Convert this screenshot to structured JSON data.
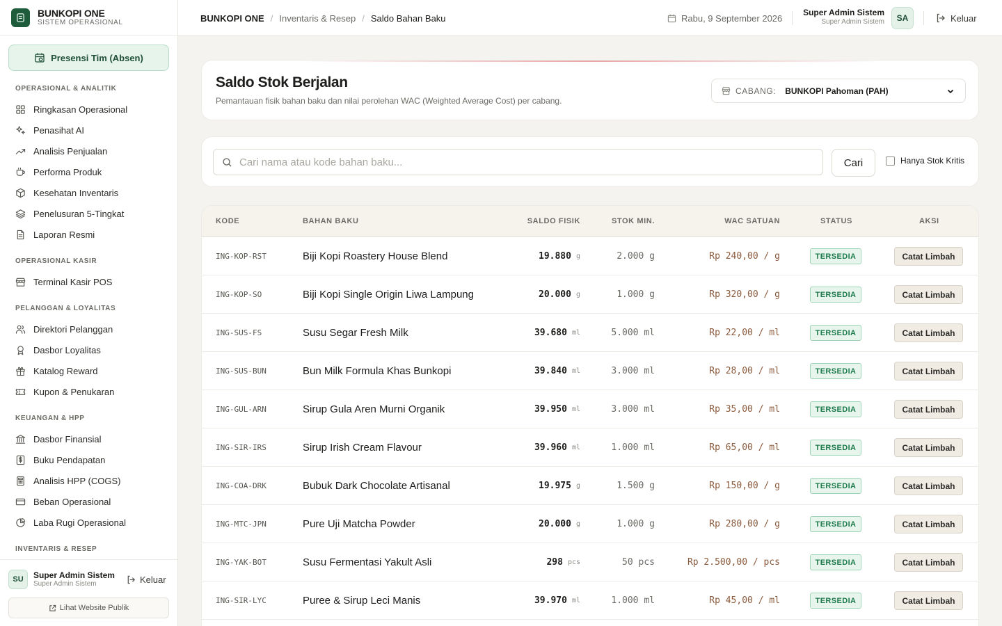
{
  "brand": {
    "name": "BUNKOPI ONE",
    "subtitle": "SISTEM OPERASIONAL"
  },
  "sidebar": {
    "absen_label": "Presensi Tim (Absen)",
    "sections": [
      {
        "title": "OPERASIONAL & ANALITIK",
        "items": [
          {
            "label": "Ringkasan Operasional",
            "icon": "grid-icon"
          },
          {
            "label": "Penasihat AI",
            "icon": "sparkles-icon"
          },
          {
            "label": "Analisis Penjualan",
            "icon": "trending-up-icon"
          },
          {
            "label": "Performa Produk",
            "icon": "cup-icon"
          },
          {
            "label": "Kesehatan Inventaris",
            "icon": "box-icon"
          },
          {
            "label": "Penelusuran 5-Tingkat",
            "icon": "layers-icon"
          },
          {
            "label": "Laporan Resmi",
            "icon": "file-icon"
          }
        ]
      },
      {
        "title": "OPERASIONAL KASIR",
        "items": [
          {
            "label": "Terminal Kasir POS",
            "icon": "store-icon"
          }
        ]
      },
      {
        "title": "PELANGGAN & LOYALITAS",
        "items": [
          {
            "label": "Direktori Pelanggan",
            "icon": "users-icon"
          },
          {
            "label": "Dasbor Loyalitas",
            "icon": "award-icon"
          },
          {
            "label": "Katalog Reward",
            "icon": "gift-icon"
          },
          {
            "label": "Kupon & Penukaran",
            "icon": "ticket-icon"
          }
        ]
      },
      {
        "title": "KEUANGAN & HPP",
        "items": [
          {
            "label": "Dasbor Finansial",
            "icon": "bank-icon"
          },
          {
            "label": "Buku Pendapatan",
            "icon": "dollar-icon"
          },
          {
            "label": "Analisis HPP (COGS)",
            "icon": "calculator-icon"
          },
          {
            "label": "Beban Operasional",
            "icon": "card-icon"
          },
          {
            "label": "Laba Rugi Operasional",
            "icon": "pie-icon"
          }
        ]
      },
      {
        "title": "INVENTARIS & RESEP",
        "items": []
      }
    ],
    "user": {
      "initials": "SU",
      "name": "Super Admin Sistem",
      "role": "Super Admin Sistem"
    },
    "logout_label": "Keluar",
    "public_label": "Lihat Website Publik"
  },
  "topbar": {
    "breadcrumbs": [
      "BUNKOPI ONE",
      "Inventaris & Resep",
      "Saldo Bahan Baku"
    ],
    "date": "Rabu, 9 September 2026",
    "user_name": "Super Admin Sistem",
    "user_role": "Super Admin Sistem",
    "avatar": "SA",
    "logout_label": "Keluar"
  },
  "header": {
    "title": "Saldo Stok Berjalan",
    "subtitle": "Pemantauan fisik bahan baku dan nilai perolehan WAC (Weighted Average Cost) per cabang.",
    "branch_label": "CABANG:",
    "branch_value": "BUNKOPI Pahoman (PAH)"
  },
  "search": {
    "placeholder": "Cari nama atau kode bahan baku...",
    "button": "Cari",
    "critical_only_label": "Hanya Stok Kritis",
    "critical_only_checked": false
  },
  "table": {
    "headers": {
      "kode": "KODE",
      "bahan": "BAHAN BAKU",
      "saldo": "SALDO FISIK",
      "min": "STOK MIN.",
      "wac": "WAC SATUAN",
      "status": "STATUS",
      "aksi": "AKSI"
    },
    "action_label": "Catat Limbah",
    "rows": [
      {
        "kode": "ING-KOP-RST",
        "nama": "Biji Kopi Roastery House Blend",
        "saldo": "19.880",
        "unit": "g",
        "min": "2.000 g",
        "wac": "Rp 240,00 / g",
        "status": "TERSEDIA"
      },
      {
        "kode": "ING-KOP-SO",
        "nama": "Biji Kopi Single Origin Liwa Lampung",
        "saldo": "20.000",
        "unit": "g",
        "min": "1.000 g",
        "wac": "Rp 320,00 / g",
        "status": "TERSEDIA"
      },
      {
        "kode": "ING-SUS-FS",
        "nama": "Susu Segar Fresh Milk",
        "saldo": "39.680",
        "unit": "ml",
        "min": "5.000 ml",
        "wac": "Rp 22,00 / ml",
        "status": "TERSEDIA"
      },
      {
        "kode": "ING-SUS-BUN",
        "nama": "Bun Milk Formula Khas Bunkopi",
        "saldo": "39.840",
        "unit": "ml",
        "min": "3.000 ml",
        "wac": "Rp 28,00 / ml",
        "status": "TERSEDIA"
      },
      {
        "kode": "ING-GUL-ARN",
        "nama": "Sirup Gula Aren Murni Organik",
        "saldo": "39.950",
        "unit": "ml",
        "min": "3.000 ml",
        "wac": "Rp 35,00 / ml",
        "status": "TERSEDIA"
      },
      {
        "kode": "ING-SIR-IRS",
        "nama": "Sirup Irish Cream Flavour",
        "saldo": "39.960",
        "unit": "ml",
        "min": "1.000 ml",
        "wac": "Rp 65,00 / ml",
        "status": "TERSEDIA"
      },
      {
        "kode": "ING-COA-DRK",
        "nama": "Bubuk Dark Chocolate Artisanal",
        "saldo": "19.975",
        "unit": "g",
        "min": "1.500 g",
        "wac": "Rp 150,00 / g",
        "status": "TERSEDIA"
      },
      {
        "kode": "ING-MTC-JPN",
        "nama": "Pure Uji Matcha Powder",
        "saldo": "20.000",
        "unit": "g",
        "min": "1.000 g",
        "wac": "Rp 280,00 / g",
        "status": "TERSEDIA"
      },
      {
        "kode": "ING-YAK-BOT",
        "nama": "Susu Fermentasi Yakult Asli",
        "saldo": "298",
        "unit": "pcs",
        "min": "50 pcs",
        "wac": "Rp 2.500,00 / pcs",
        "status": "TERSEDIA"
      },
      {
        "kode": "ING-SIR-LYC",
        "nama": "Puree & Sirup Leci Manis",
        "saldo": "39.970",
        "unit": "ml",
        "min": "1.000 ml",
        "wac": "Rp 45,00 / ml",
        "status": "TERSEDIA"
      }
    ]
  },
  "colors": {
    "brand_green": "#1f5c3b",
    "status_green": "#1c7a4b",
    "wac_brown": "#8a5a3c"
  }
}
